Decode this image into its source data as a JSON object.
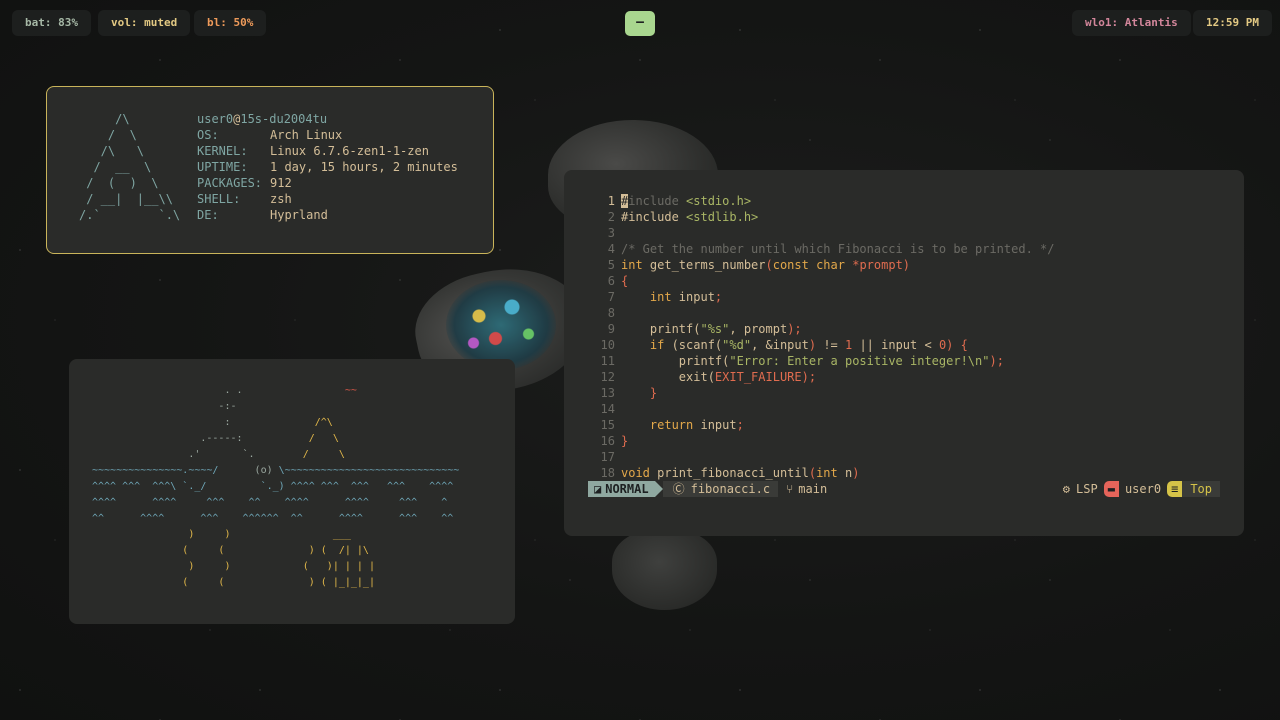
{
  "topbar": {
    "battery": "bat: 83%",
    "volume": "vol: muted",
    "backlight": "bl: 50%",
    "workspace": "—",
    "wifi": "wlo1: Atlantis",
    "clock": "12:59 PM"
  },
  "fetch": {
    "logo": [
      "     /\\",
      "    /  \\",
      "   /\\   \\",
      "  /  __  \\",
      " /  (  )  \\",
      " / __|  |__\\\\",
      "/.`        `.\\"
    ],
    "user": "user0",
    "at": "@",
    "host": "15s-du2004tu",
    "rows": [
      {
        "key": "OS:",
        "value": "Arch Linux"
      },
      {
        "key": "KERNEL:",
        "value": "Linux 6.7.6-zen1-1-zen"
      },
      {
        "key": "UPTIME:",
        "value": "1 day, 15 hours, 2 minutes"
      },
      {
        "key": "PACKAGES:",
        "value": "912"
      },
      {
        "key": "SHELL:",
        "value": "zsh"
      },
      {
        "key": "DE:",
        "value": "Hyprland"
      }
    ]
  },
  "ascii": {
    "lines": [
      [
        {
          "c": "c-gr",
          "t": "                      . .                 "
        },
        {
          "c": "c-re",
          "t": "~~"
        }
      ],
      [
        {
          "c": "c-gr",
          "t": "                     -:-"
        }
      ],
      [
        {
          "c": "c-gr",
          "t": "                      :              "
        },
        {
          "c": "c-ye",
          "t": "/^\\"
        }
      ],
      [
        {
          "c": "c-gr",
          "t": "                  .-----:           "
        },
        {
          "c": "c-ye",
          "t": "/   \\"
        }
      ],
      [
        {
          "c": "c-gr",
          "t": "                .'       `.        "
        },
        {
          "c": "c-ye",
          "t": "/     \\"
        }
      ],
      [
        {
          "c": "c-wa",
          "t": "~~~~~~~~~~~~~~~.~~~~/"
        },
        {
          "c": "c-gr",
          "t": "      (o) "
        },
        {
          "c": "c-wa",
          "t": "\\~~~~~~~~~~~~~~~~~~~~~~~~~~~~~"
        }
      ],
      [
        {
          "c": "c-wa",
          "t": "^^^^ ^^^  ^^^\\ `._/         `._) ^^^^ ^^^  ^^^   ^^^    ^^^^"
        }
      ],
      [
        {
          "c": "c-wa",
          "t": "^^^^      ^^^^     ^^^    ^^    ^^^^      ^^^^     ^^^    ^"
        }
      ],
      [
        {
          "c": "c-wa",
          "t": "^^      ^^^^      ^^^    ^^^^^^  ^^      ^^^^      ^^^    ^^"
        }
      ],
      [
        {
          "c": "c-ye",
          "t": "                )     )                 ___"
        }
      ],
      [
        {
          "c": "c-ye",
          "t": "               (     (              ) (  /| |\\"
        }
      ],
      [
        {
          "c": "c-ye",
          "t": "                )     )            (   )| | | |"
        }
      ],
      [
        {
          "c": "c-ye",
          "t": "               (     (              ) ( |_|_|_|"
        }
      ]
    ]
  },
  "editor": {
    "lines": [
      {
        "n": "1",
        "cur": true,
        "p": [
          {
            "c": "cursor",
            "t": "#"
          },
          {
            "c": "cm2",
            "t": "include "
          },
          {
            "c": "str",
            "t": "<stdio.h>"
          }
        ]
      },
      {
        "n": "2",
        "p": [
          {
            "c": "fn",
            "t": "#include "
          },
          {
            "c": "str",
            "t": "<stdlib.h>"
          }
        ]
      },
      {
        "n": "3",
        "p": []
      },
      {
        "n": "4",
        "p": [
          {
            "c": "cm",
            "t": "/* Get the number until which Fibonacci is to be printed. */"
          }
        ]
      },
      {
        "n": "5",
        "p": [
          {
            "c": "ty",
            "t": "int "
          },
          {
            "c": "fn",
            "t": "get_terms_number"
          },
          {
            "c": "pn",
            "t": "("
          },
          {
            "c": "ty",
            "t": "const char "
          },
          {
            "c": "pn",
            "t": "*prompt)"
          }
        ]
      },
      {
        "n": "6",
        "p": [
          {
            "c": "pn",
            "t": "{"
          }
        ]
      },
      {
        "n": "7",
        "p": [
          {
            "c": "ty",
            "t": "    int "
          },
          {
            "c": "fn",
            "t": "input"
          },
          {
            "c": "pn",
            "t": ";"
          }
        ]
      },
      {
        "n": "8",
        "p": []
      },
      {
        "n": "9",
        "p": [
          {
            "c": "fn",
            "t": "    printf("
          },
          {
            "c": "str",
            "t": "\"%s\""
          },
          {
            "c": "fn",
            "t": ", prompt"
          },
          {
            "c": "pn",
            "t": ");"
          }
        ]
      },
      {
        "n": "10",
        "p": [
          {
            "c": "kw",
            "t": "    if "
          },
          {
            "c": "fn",
            "t": "(scanf("
          },
          {
            "c": "str",
            "t": "\"%d\""
          },
          {
            "c": "fn",
            "t": ", &input"
          },
          {
            "c": "pn",
            "t": ") "
          },
          {
            "c": "fn",
            "t": "!= "
          },
          {
            "c": "nm",
            "t": "1 "
          },
          {
            "c": "fn",
            "t": "|| input < "
          },
          {
            "c": "nm",
            "t": "0"
          },
          {
            "c": "pn",
            "t": ") {"
          }
        ]
      },
      {
        "n": "11",
        "p": [
          {
            "c": "fn",
            "t": "        printf("
          },
          {
            "c": "str",
            "t": "\"Error: Enter a positive integer!\\n\""
          },
          {
            "c": "pn",
            "t": ");"
          }
        ]
      },
      {
        "n": "12",
        "p": [
          {
            "c": "fn",
            "t": "        exit("
          },
          {
            "c": "mc",
            "t": "EXIT_FAILURE"
          },
          {
            "c": "pn",
            "t": ");"
          }
        ]
      },
      {
        "n": "13",
        "p": [
          {
            "c": "pn",
            "t": "    }"
          }
        ]
      },
      {
        "n": "14",
        "p": []
      },
      {
        "n": "15",
        "p": [
          {
            "c": "kw",
            "t": "    return "
          },
          {
            "c": "fn",
            "t": "input"
          },
          {
            "c": "pn",
            "t": ";"
          }
        ]
      },
      {
        "n": "16",
        "p": [
          {
            "c": "pn",
            "t": "}"
          }
        ]
      },
      {
        "n": "17",
        "p": []
      },
      {
        "n": "18",
        "p": [
          {
            "c": "ty",
            "t": "void "
          },
          {
            "c": "fn",
            "t": "print_fibonacci_until"
          },
          {
            "c": "pn",
            "t": "("
          },
          {
            "c": "ty",
            "t": "int "
          },
          {
            "c": "fn",
            "t": "n"
          },
          {
            "c": "pn",
            "t": ")"
          }
        ]
      }
    ],
    "status": {
      "mode": "NORMAL",
      "file": "fibonacci.c",
      "branch": "main",
      "lsp": "LSP",
      "user": "user0",
      "position": "Top"
    }
  }
}
